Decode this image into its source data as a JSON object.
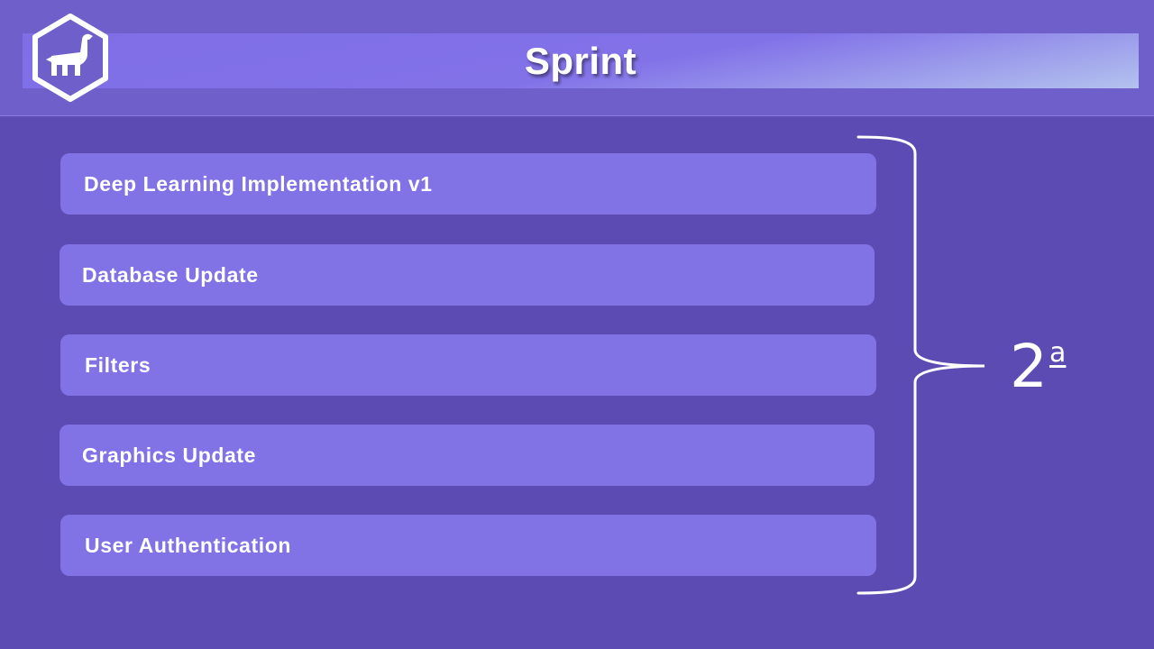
{
  "header": {
    "title": "Sprint",
    "logo_icon": "hexagon-dinosaur-logo-icon"
  },
  "items": [
    {
      "label": "Deep Learning Implementation v1"
    },
    {
      "label": "Database Update"
    },
    {
      "label": "Filters"
    },
    {
      "label": "Graphics Update"
    },
    {
      "label": "User Authentication"
    }
  ],
  "sprint": {
    "number": "2",
    "ordinal": "a"
  },
  "colors": {
    "background": "#5b4bb3",
    "header": "#6f5fcb",
    "item": "#8172e6",
    "text": "#ffffff"
  }
}
